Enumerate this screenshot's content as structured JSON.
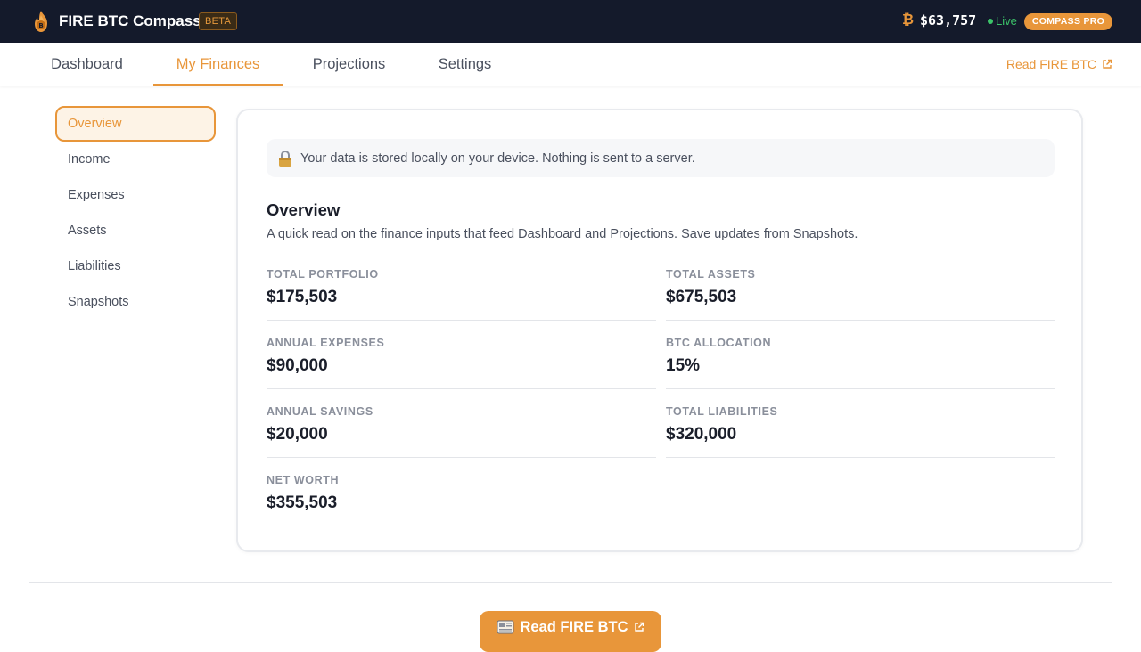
{
  "header": {
    "app_name": "FIRE BTC Compass",
    "beta_label": "BETA",
    "btc_symbol": "₿",
    "btc_price": "$63,757",
    "live_label": "Live",
    "pro_label": "COMPASS PRO"
  },
  "nav": {
    "tabs": [
      {
        "label": "Dashboard"
      },
      {
        "label": "My Finances"
      },
      {
        "label": "Projections"
      },
      {
        "label": "Settings"
      }
    ],
    "active_tab": "My Finances",
    "read_link": "Read FIRE BTC"
  },
  "sidebar": {
    "items": [
      {
        "label": "Overview"
      },
      {
        "label": "Income"
      },
      {
        "label": "Expenses"
      },
      {
        "label": "Assets"
      },
      {
        "label": "Liabilities"
      },
      {
        "label": "Snapshots"
      }
    ],
    "active_item": "Overview"
  },
  "main": {
    "notice": "Your data is stored locally on your device. Nothing is sent to a server.",
    "title": "Overview",
    "description": "A quick read on the finance inputs that feed Dashboard and Projections. Save updates from Snapshots.",
    "stats": [
      {
        "label": "Total Portfolio",
        "value": "$175,503"
      },
      {
        "label": "Total Assets",
        "value": "$675,503"
      },
      {
        "label": "Annual Expenses",
        "value": "$90,000"
      },
      {
        "label": "BTC Allocation",
        "value": "15%"
      },
      {
        "label": "Annual Savings",
        "value": "$20,000"
      },
      {
        "label": "Total Liabilities",
        "value": "$320,000"
      },
      {
        "label": "Net Worth",
        "value": "$355,503"
      }
    ]
  },
  "footer": {
    "cta_label": "Read FIRE BTC"
  },
  "colors": {
    "accent": "#e8963a",
    "topbar": "#141a2b",
    "live": "#3cc46a"
  }
}
